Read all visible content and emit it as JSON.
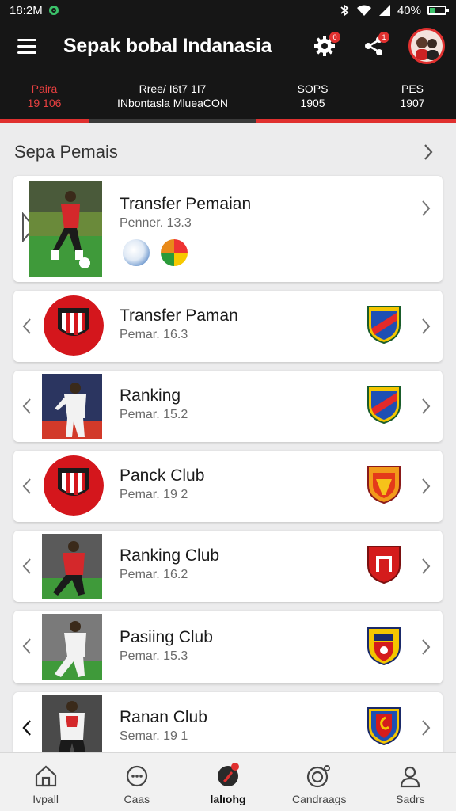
{
  "status_bar": {
    "time": "18:2M",
    "battery": "40%",
    "battery_level": 0.4
  },
  "app_bar": {
    "title": "Sepak bobal Indanasia",
    "settings_badge": "0",
    "share_badge": "1"
  },
  "score_tabs": [
    {
      "line1": "Paira",
      "line2": "19 106",
      "active": true
    },
    {
      "line1": "Rree/ I6t7 1I7",
      "line2": "INbontasla MlueaCON",
      "active": false
    },
    {
      "line1": "SOPS",
      "line2": "1905",
      "active": false
    },
    {
      "line1": "PES",
      "line2": "1907",
      "active": false
    }
  ],
  "section": {
    "title": "Sepa Pemais"
  },
  "cards": [
    {
      "title": "Transfer Pemaian",
      "subtitle": "Penner. 13.3",
      "thumb": "player-red-photo",
      "extra": [
        "volleyball-icon",
        "soccer-ball-icon"
      ]
    },
    {
      "title": "Transfer Paman",
      "subtitle": "Pemar. 16.3",
      "thumb": "club-logo-red",
      "shield": "shield-blue-red-icon"
    },
    {
      "title": "Ranking",
      "subtitle": "Pemar. 15.2",
      "thumb": "player-white-photo",
      "shield": "shield-blue-red-icon"
    },
    {
      "title": "Panck Club",
      "subtitle": "Pemar. 19 2",
      "thumb": "club-logo-red",
      "shield": "shield-orange-red-icon"
    },
    {
      "title": "Ranking Club",
      "subtitle": "Pemar. 16.2",
      "thumb": "player-red-photo",
      "shield": "shield-red-icon"
    },
    {
      "title": "Pasiing Club",
      "subtitle": "Pemar. 15.3",
      "thumb": "player-white-photo",
      "shield": "shield-yellow-red-icon"
    },
    {
      "title": "Ranan Club",
      "subtitle": "Semar. 19 1",
      "thumb": "player-white-photo",
      "shield": "shield-red-blue-icon"
    }
  ],
  "bottom_nav": [
    {
      "label": "Ivpall",
      "icon": "home-icon",
      "active": false
    },
    {
      "label": "Caas",
      "icon": "chat-bubble-icon",
      "active": false
    },
    {
      "label": "lalıohg",
      "icon": "soccer-kick-icon",
      "active": true
    },
    {
      "label": "Candraags",
      "icon": "target-icon",
      "active": false
    },
    {
      "label": "Sadrs",
      "icon": "person-icon",
      "active": false
    }
  ],
  "colors": {
    "accent": "#e0302f",
    "bar_bg": "#161616",
    "page_bg": "#ececed",
    "card_bg": "#ffffff"
  }
}
